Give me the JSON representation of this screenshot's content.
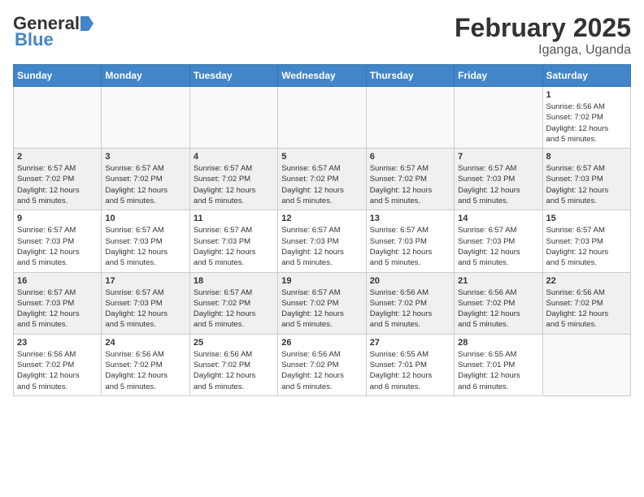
{
  "header": {
    "logo_general": "General",
    "logo_blue": "Blue",
    "title": "February 2025",
    "subtitle": "Iganga, Uganda"
  },
  "weekdays": [
    "Sunday",
    "Monday",
    "Tuesday",
    "Wednesday",
    "Thursday",
    "Friday",
    "Saturday"
  ],
  "weeks": [
    [
      {
        "day": "",
        "info": ""
      },
      {
        "day": "",
        "info": ""
      },
      {
        "day": "",
        "info": ""
      },
      {
        "day": "",
        "info": ""
      },
      {
        "day": "",
        "info": ""
      },
      {
        "day": "",
        "info": ""
      },
      {
        "day": "1",
        "info": "Sunrise: 6:56 AM\nSunset: 7:02 PM\nDaylight: 12 hours\nand 5 minutes."
      }
    ],
    [
      {
        "day": "2",
        "info": "Sunrise: 6:57 AM\nSunset: 7:02 PM\nDaylight: 12 hours\nand 5 minutes."
      },
      {
        "day": "3",
        "info": "Sunrise: 6:57 AM\nSunset: 7:02 PM\nDaylight: 12 hours\nand 5 minutes."
      },
      {
        "day": "4",
        "info": "Sunrise: 6:57 AM\nSunset: 7:02 PM\nDaylight: 12 hours\nand 5 minutes."
      },
      {
        "day": "5",
        "info": "Sunrise: 6:57 AM\nSunset: 7:02 PM\nDaylight: 12 hours\nand 5 minutes."
      },
      {
        "day": "6",
        "info": "Sunrise: 6:57 AM\nSunset: 7:02 PM\nDaylight: 12 hours\nand 5 minutes."
      },
      {
        "day": "7",
        "info": "Sunrise: 6:57 AM\nSunset: 7:03 PM\nDaylight: 12 hours\nand 5 minutes."
      },
      {
        "day": "8",
        "info": "Sunrise: 6:57 AM\nSunset: 7:03 PM\nDaylight: 12 hours\nand 5 minutes."
      }
    ],
    [
      {
        "day": "9",
        "info": "Sunrise: 6:57 AM\nSunset: 7:03 PM\nDaylight: 12 hours\nand 5 minutes."
      },
      {
        "day": "10",
        "info": "Sunrise: 6:57 AM\nSunset: 7:03 PM\nDaylight: 12 hours\nand 5 minutes."
      },
      {
        "day": "11",
        "info": "Sunrise: 6:57 AM\nSunset: 7:03 PM\nDaylight: 12 hours\nand 5 minutes."
      },
      {
        "day": "12",
        "info": "Sunrise: 6:57 AM\nSunset: 7:03 PM\nDaylight: 12 hours\nand 5 minutes."
      },
      {
        "day": "13",
        "info": "Sunrise: 6:57 AM\nSunset: 7:03 PM\nDaylight: 12 hours\nand 5 minutes."
      },
      {
        "day": "14",
        "info": "Sunrise: 6:57 AM\nSunset: 7:03 PM\nDaylight: 12 hours\nand 5 minutes."
      },
      {
        "day": "15",
        "info": "Sunrise: 6:57 AM\nSunset: 7:03 PM\nDaylight: 12 hours\nand 5 minutes."
      }
    ],
    [
      {
        "day": "16",
        "info": "Sunrise: 6:57 AM\nSunset: 7:03 PM\nDaylight: 12 hours\nand 5 minutes."
      },
      {
        "day": "17",
        "info": "Sunrise: 6:57 AM\nSunset: 7:03 PM\nDaylight: 12 hours\nand 5 minutes."
      },
      {
        "day": "18",
        "info": "Sunrise: 6:57 AM\nSunset: 7:02 PM\nDaylight: 12 hours\nand 5 minutes."
      },
      {
        "day": "19",
        "info": "Sunrise: 6:57 AM\nSunset: 7:02 PM\nDaylight: 12 hours\nand 5 minutes."
      },
      {
        "day": "20",
        "info": "Sunrise: 6:56 AM\nSunset: 7:02 PM\nDaylight: 12 hours\nand 5 minutes."
      },
      {
        "day": "21",
        "info": "Sunrise: 6:56 AM\nSunset: 7:02 PM\nDaylight: 12 hours\nand 5 minutes."
      },
      {
        "day": "22",
        "info": "Sunrise: 6:56 AM\nSunset: 7:02 PM\nDaylight: 12 hours\nand 5 minutes."
      }
    ],
    [
      {
        "day": "23",
        "info": "Sunrise: 6:56 AM\nSunset: 7:02 PM\nDaylight: 12 hours\nand 5 minutes."
      },
      {
        "day": "24",
        "info": "Sunrise: 6:56 AM\nSunset: 7:02 PM\nDaylight: 12 hours\nand 5 minutes."
      },
      {
        "day": "25",
        "info": "Sunrise: 6:56 AM\nSunset: 7:02 PM\nDaylight: 12 hours\nand 5 minutes."
      },
      {
        "day": "26",
        "info": "Sunrise: 6:56 AM\nSunset: 7:02 PM\nDaylight: 12 hours\nand 5 minutes."
      },
      {
        "day": "27",
        "info": "Sunrise: 6:55 AM\nSunset: 7:01 PM\nDaylight: 12 hours\nand 6 minutes."
      },
      {
        "day": "28",
        "info": "Sunrise: 6:55 AM\nSunset: 7:01 PM\nDaylight: 12 hours\nand 6 minutes."
      },
      {
        "day": "",
        "info": ""
      }
    ]
  ]
}
